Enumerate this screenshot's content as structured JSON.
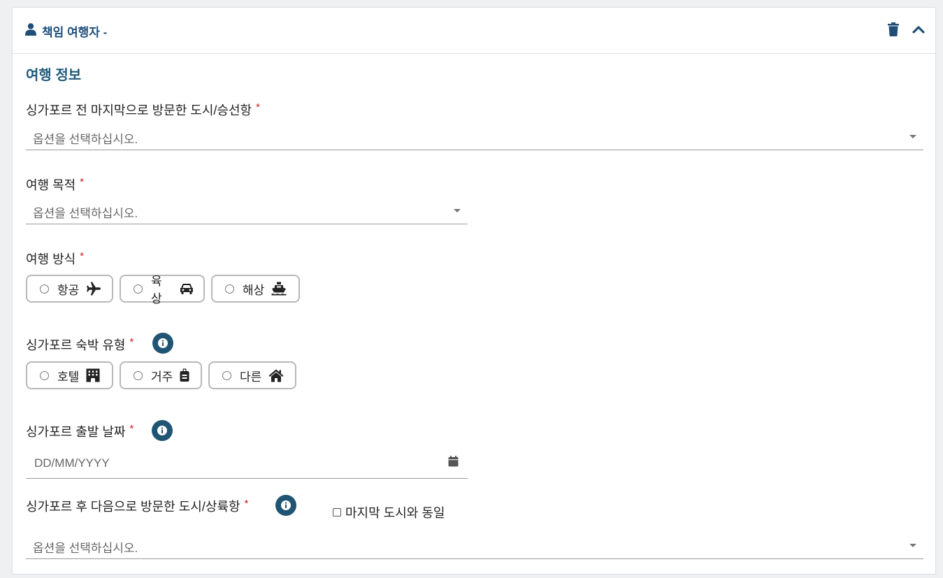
{
  "header": {
    "title": "책임 여행자 -",
    "icons": [
      "user-icon",
      "trash-icon",
      "chevron-up-icon"
    ]
  },
  "section": {
    "title": "여행 정보"
  },
  "fields": {
    "last_city": {
      "label": "싱가포르 전 마지막으로 방문한 도시/승선항",
      "placeholder": "옵션을 선택하십시오."
    },
    "purpose": {
      "label": "여행 목적",
      "placeholder": "옵션을 선택하십시오."
    },
    "mode": {
      "label": "여행 방식",
      "options": [
        {
          "label": "항공",
          "icon": "plane-icon"
        },
        {
          "label": "육상",
          "icon": "car-icon"
        },
        {
          "label": "해상",
          "icon": "ship-icon"
        }
      ]
    },
    "accommodation": {
      "label": "싱가포르 숙박 유형",
      "options": [
        {
          "label": "호텔",
          "icon": "hotel-icon"
        },
        {
          "label": "거주",
          "icon": "suitcase-icon"
        },
        {
          "label": "다른",
          "icon": "home-icon"
        }
      ]
    },
    "departure_date": {
      "label": "싱가포르 출발 날짜",
      "placeholder": "DD/MM/YYYY"
    },
    "next_city": {
      "label": "싱가포르 후 다음으로 방문한 도시/상륙항",
      "same_as_last_label": "마지막 도시와 동일",
      "placeholder": "옵션을 선택하십시오."
    }
  },
  "required_marker": "*",
  "colors": {
    "accent": "#1f5473",
    "title": "#1f4e79",
    "required": "#cc1f1f"
  }
}
